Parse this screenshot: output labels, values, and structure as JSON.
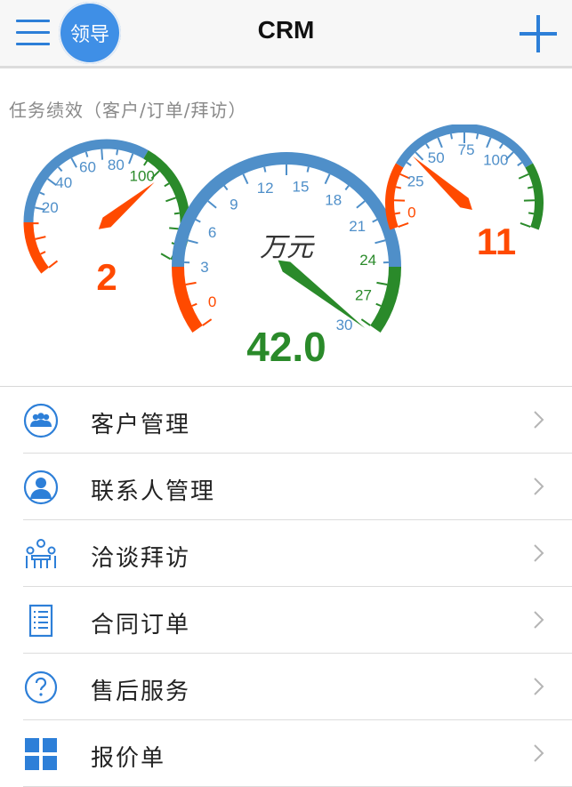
{
  "header": {
    "title": "CRM",
    "avatar_label": "领导"
  },
  "performance": {
    "section_title": "任务绩效（客户/订单/拜访）",
    "gauges": [
      {
        "id": "left",
        "ticks": [
          "20",
          "40",
          "60",
          "80",
          "100"
        ],
        "value_display": "2",
        "value": 2,
        "max": 100,
        "value_color": "#ff4a00"
      },
      {
        "id": "center",
        "ticks": [
          "0",
          "3",
          "6",
          "9",
          "12",
          "15",
          "18",
          "21",
          "24",
          "27",
          "30"
        ],
        "unit": "万元",
        "value_display": "42.0",
        "value": 42.0,
        "max": 30,
        "value_color": "#2a8a2a"
      },
      {
        "id": "right",
        "ticks": [
          "0",
          "25",
          "50",
          "75",
          "100"
        ],
        "value_display": "11",
        "value": 11,
        "max": 100,
        "value_color": "#ff4a00"
      }
    ]
  },
  "menu": {
    "items": [
      {
        "label": "客户管理",
        "icon": "customers-icon"
      },
      {
        "label": "联系人管理",
        "icon": "contact-person-icon"
      },
      {
        "label": "洽谈拜访",
        "icon": "meeting-icon"
      },
      {
        "label": "合同订单",
        "icon": "document-icon"
      },
      {
        "label": "售后服务",
        "icon": "help-icon"
      },
      {
        "label": "报价单",
        "icon": "grid-icon"
      }
    ]
  },
  "colors": {
    "accent": "#2d7fd8",
    "gauge_blue": "#4f8fc9",
    "gauge_red": "#ff4a00",
    "gauge_green": "#2a8a2a"
  }
}
